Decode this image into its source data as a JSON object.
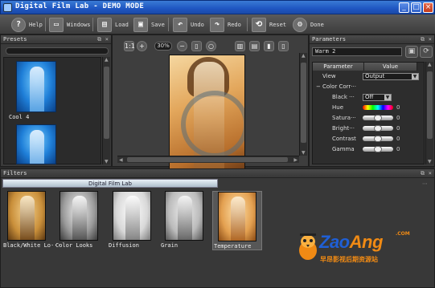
{
  "window": {
    "title": "Digital Film Lab - DEMO MODE"
  },
  "toolbar": {
    "help_label": "Help",
    "windows_label": "Windows",
    "load_label": "Load",
    "save_label": "Save",
    "undo_label": "Undo",
    "redo_label": "Redo",
    "reset_label": "Reset",
    "done_label": "Done"
  },
  "presets": {
    "title": "Presets",
    "items": [
      {
        "label": "Cool 4"
      },
      {
        "label": ""
      }
    ]
  },
  "viewer": {
    "zoom": "30%"
  },
  "parameters": {
    "title": "Parameters",
    "preset_name": "Warm 2",
    "col_param": "Parameter",
    "col_value": "Value",
    "view_label": "View",
    "view_value": "Output",
    "group_label": "Color Corr···",
    "black_label": "Black ···",
    "black_value": "Off",
    "hue_label": "Hue",
    "hue_value": "0",
    "saturation_label": "Satura···",
    "saturation_value": "0",
    "brightness_label": "Bright···",
    "brightness_value": "0",
    "contrast_label": "Contrast",
    "contrast_value": "0",
    "gamma_label": "Gamma",
    "gamma_value": "0"
  },
  "filters": {
    "title": "Filters",
    "tab_label": "Digital Film Lab",
    "items": [
      {
        "label": "Black/White Lo···",
        "tint": "#c98f3a"
      },
      {
        "label": "Color Looks",
        "tint": "#9a9a9a"
      },
      {
        "label": "Diffusion",
        "tint": "#d8d8d8"
      },
      {
        "label": "Grain",
        "tint": "#bbbbbb"
      },
      {
        "label": "Temperature",
        "tint": "#e3a050"
      }
    ]
  },
  "watermark": {
    "brand_a": "Zao",
    "brand_b": "Ang",
    "com": ".COM",
    "cn": "早昂影视后期资源站"
  }
}
